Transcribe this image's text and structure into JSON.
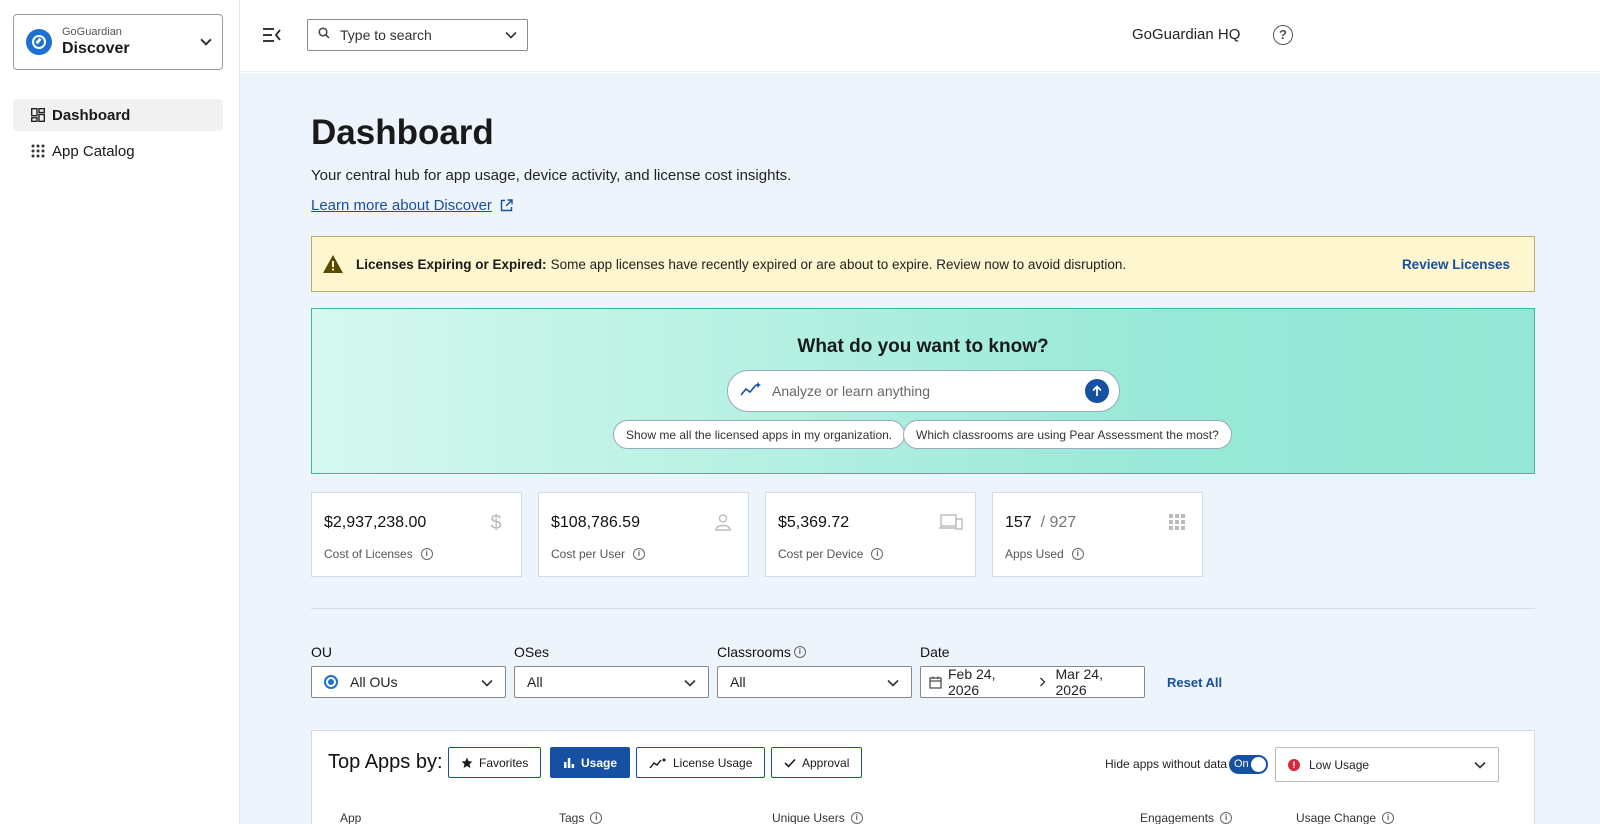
{
  "sidebar": {
    "app_switcher": {
      "brand": "GoGuardian",
      "product": "Discover"
    },
    "items": [
      {
        "label": "Dashboard",
        "active": true
      },
      {
        "label": "App Catalog",
        "active": false
      }
    ]
  },
  "topbar": {
    "search_placeholder": "Type to search",
    "org_name": "GoGuardian HQ"
  },
  "page": {
    "title": "Dashboard",
    "description": "Your central hub for app usage, device activity, and license cost insights.",
    "learn_link": "Learn more about Discover"
  },
  "alert": {
    "title": "Licenses Expiring or Expired:",
    "message": "Some app licenses have recently expired or are about to expire. Review now to avoid disruption.",
    "action": "Review Licenses"
  },
  "ask": {
    "title": "What do you want to know?",
    "placeholder": "Analyze or learn anything",
    "suggestions": [
      "Show me all the licensed apps in my organization.",
      "Which classrooms are using Pear Assessment the most?"
    ]
  },
  "stats": [
    {
      "value": "$2,937,238.00",
      "label": "Cost of Licenses",
      "icon": "dollar-icon"
    },
    {
      "value": "$108,786.59",
      "label": "Cost per User",
      "icon": "person-icon"
    },
    {
      "value": "$5,369.72",
      "label": "Cost per Device",
      "icon": "devices-icon"
    },
    {
      "value": "157",
      "value_total": "/ 927",
      "label": "Apps Used",
      "icon": "apps-grid-icon"
    }
  ],
  "filters": {
    "ou": {
      "label": "OU",
      "value": "All OUs"
    },
    "oses": {
      "label": "OSes",
      "value": "All"
    },
    "classrooms": {
      "label": "Classrooms",
      "value": "All"
    },
    "date": {
      "label": "Date",
      "start": "Feb 24, 2026",
      "end": "Mar 24, 2026"
    },
    "reset": "Reset All"
  },
  "top_apps": {
    "title": "Top Apps by:",
    "tabs": [
      {
        "label": "Favorites",
        "active": false
      },
      {
        "label": "Usage",
        "active": true
      },
      {
        "label": "License Usage",
        "active": false
      },
      {
        "label": "Approval",
        "active": false
      }
    ],
    "hide_label": "Hide apps without data",
    "toggle_text": "On",
    "usage_filter": "Low Usage",
    "columns": [
      "App",
      "Tags",
      "Unique Users",
      "Engagements",
      "Usage Change"
    ]
  },
  "colors": {
    "primary": "#1650a3",
    "alert_bg": "#fdf6cf",
    "main_bg": "#eef4fc",
    "danger": "#d42b3c"
  }
}
